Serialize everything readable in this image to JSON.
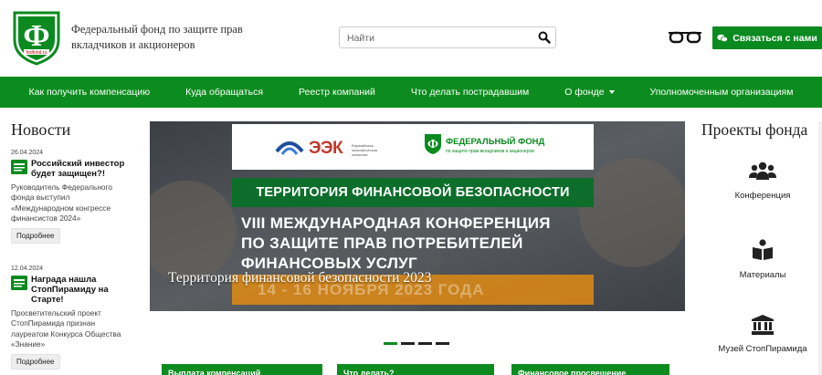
{
  "header": {
    "org_name": "Федеральный фонд по защите прав вкладчиков и акционеров",
    "logo_caption": "fedfond.ru",
    "search_placeholder": "Найти",
    "contact_label": "Связаться с нами"
  },
  "nav": {
    "items": [
      {
        "label": "Как получить компенсацию"
      },
      {
        "label": "Куда обращаться"
      },
      {
        "label": "Реестр компаний"
      },
      {
        "label": "Что делать пострадавшим"
      },
      {
        "label": "О фонде",
        "has_dropdown": true
      },
      {
        "label": "Уполномоченным организациям"
      }
    ]
  },
  "news": {
    "title": "Новости",
    "items": [
      {
        "date": "26.04.2024",
        "headline": "Российский инвестор будет защищен?!",
        "text": "Руководитель Федерального фонда выступил «Международном конгрессе финансистов 2024»",
        "more": "Подробнее"
      },
      {
        "date": "12.04.2024",
        "headline": "Награда нашла СтопПирамиду на Старте!",
        "text": "Просветительский проект СтопПирамида признан лауреатом Конкурса Общества «Знание»",
        "more": "Подробнее"
      }
    ]
  },
  "slider": {
    "eek_brand": "ЭЭК",
    "eek_small": "Евразийская экономическая комиссия",
    "ff_name": "ФЕДЕРАЛЬНЫЙ ФОНД",
    "ff_sub": "по защите прав вкладчиков и акционеров",
    "band_text": "ТЕРРИТОРИЯ ФИНАНСОВОЙ БЕЗОПАСНОСТИ",
    "conf_line1": "VIII МЕЖДУНАРОДНАЯ КОНФЕРЕНЦИЯ",
    "conf_line2": "ПО ЗАЩИТЕ ПРАВ ПОТРЕБИТЕЛЕЙ",
    "conf_line3": "ФИНАНСОВЫХ УСЛУГ",
    "dates": "14 - 16 НОЯБРЯ 2023 ГОДА",
    "caption": "Территория финансовой безопасности 2023",
    "slide_count": 4,
    "active_slide": 1
  },
  "cards": [
    {
      "label": "Выплата компенсаций"
    },
    {
      "label": "Что делать?"
    },
    {
      "label": "Финансовое просвещение"
    }
  ],
  "projects": {
    "title": "Проекты фонда",
    "items": [
      {
        "label": "Конференция",
        "icon": "users-icon"
      },
      {
        "label": "Материалы",
        "icon": "book-reader-icon"
      },
      {
        "label": "Музей СтопПирамида",
        "icon": "museum-icon"
      }
    ]
  },
  "colors": {
    "brand_green": "#0c8c1e",
    "band_green": "#0c6e2a",
    "accent_orange": "#e08b14"
  }
}
